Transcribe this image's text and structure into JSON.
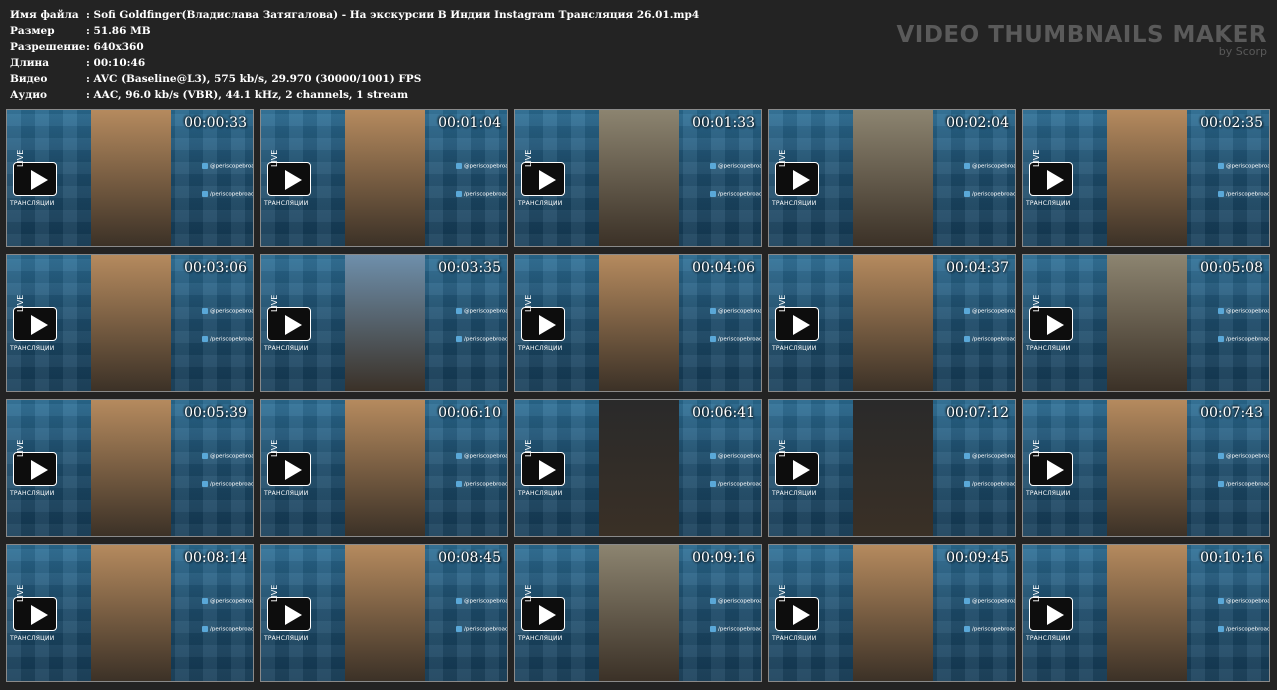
{
  "meta": [
    {
      "key": "Имя файла",
      "value": ": Sofi Goldfinger(Владислава Затягалова) - На экскурсии В Индии Instagram Трансляция 26.01.mp4"
    },
    {
      "key": "Размер",
      "value": ": 51.86 MB"
    },
    {
      "key": "Разрешение",
      "value": ": 640x360"
    },
    {
      "key": "Длина",
      "value": ": 00:10:46"
    },
    {
      "key": "Видео",
      "value": ": AVC (Baseline@L3), 575 kb/s, 29.970 (30000/1001) FPS"
    },
    {
      "key": "Аудио",
      "value": ": AAC, 96.0 kb/s (VBR), 44.1 kHz, 2 channels, 1 stream"
    }
  ],
  "brand": {
    "title": "VIDEO THUMBNAILS MAKER",
    "subtitle": "by Scorp"
  },
  "overlay": {
    "live_text": "LIVE",
    "live_sub": "ТРАНСЛЯЦИИ",
    "handle_tw": "@periscopebroad",
    "handle_vk": "/periscopebroad"
  },
  "thumbnails": [
    {
      "time": "00:00:33",
      "scene": "face"
    },
    {
      "time": "00:01:04",
      "scene": "face"
    },
    {
      "time": "00:01:33",
      "scene": "road"
    },
    {
      "time": "00:02:04",
      "scene": "road"
    },
    {
      "time": "00:02:35",
      "scene": "face"
    },
    {
      "time": "00:03:06",
      "scene": "face"
    },
    {
      "time": "00:03:35",
      "scene": "sky"
    },
    {
      "time": "00:04:06",
      "scene": "face"
    },
    {
      "time": "00:04:37",
      "scene": "face"
    },
    {
      "time": "00:05:08",
      "scene": "road"
    },
    {
      "time": "00:05:39",
      "scene": "face"
    },
    {
      "time": "00:06:10",
      "scene": "face"
    },
    {
      "time": "00:06:41",
      "scene": "dark"
    },
    {
      "time": "00:07:12",
      "scene": "dark"
    },
    {
      "time": "00:07:43",
      "scene": "face"
    },
    {
      "time": "00:08:14",
      "scene": "face"
    },
    {
      "time": "00:08:45",
      "scene": "face"
    },
    {
      "time": "00:09:16",
      "scene": "road"
    },
    {
      "time": "00:09:45",
      "scene": "face"
    },
    {
      "time": "00:10:16",
      "scene": "face"
    }
  ],
  "colors": {
    "face": "#b58a5e",
    "road": "#8c8470",
    "sky": "#6e8fab",
    "dark": "#2a2a2a"
  }
}
